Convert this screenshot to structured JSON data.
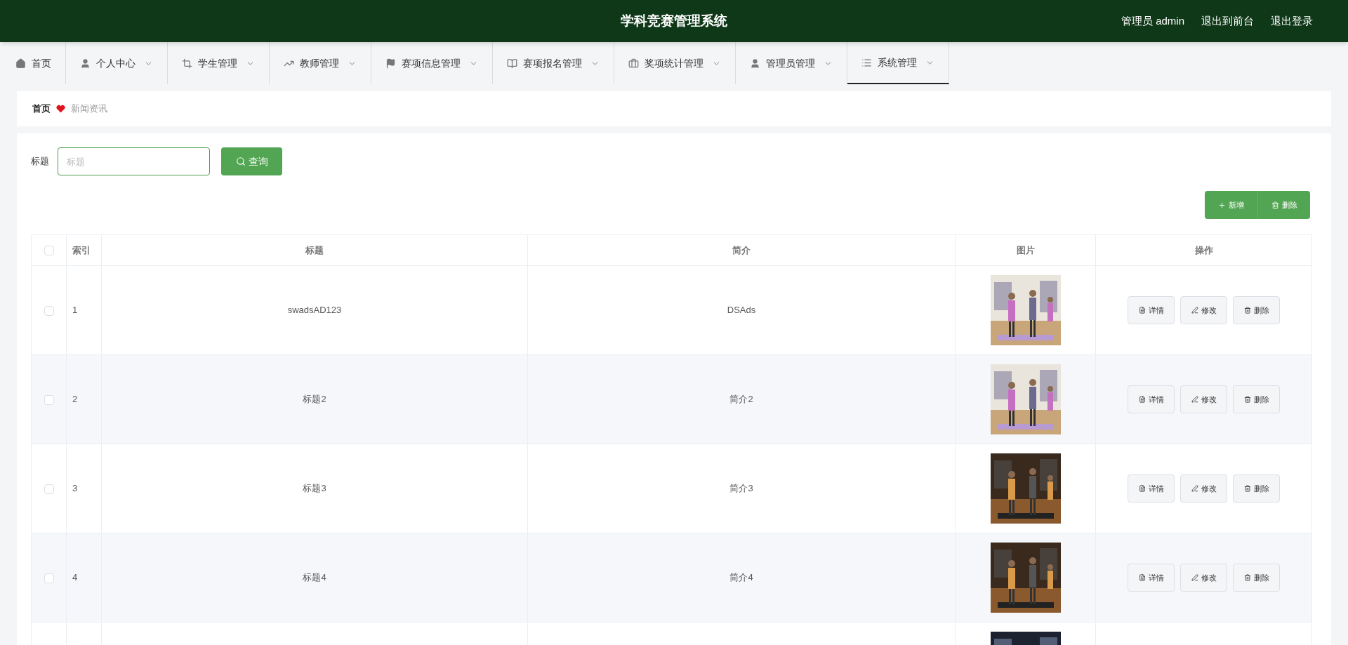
{
  "header": {
    "title": "学科竞赛管理系统",
    "user": "管理员 admin",
    "links": [
      "退出到前台",
      "退出登录"
    ]
  },
  "nav": [
    {
      "label": "首页",
      "dropdown": false,
      "selected": false
    },
    {
      "label": "个人中心",
      "dropdown": true,
      "selected": false
    },
    {
      "label": "学生管理",
      "dropdown": true,
      "selected": false
    },
    {
      "label": "教师管理",
      "dropdown": true,
      "selected": false
    },
    {
      "label": "赛项信息管理",
      "dropdown": true,
      "selected": false
    },
    {
      "label": "赛项报名管理",
      "dropdown": true,
      "selected": false
    },
    {
      "label": "奖项统计管理",
      "dropdown": true,
      "selected": false
    },
    {
      "label": "管理员管理",
      "dropdown": true,
      "selected": false
    },
    {
      "label": "系统管理",
      "dropdown": true,
      "selected": true
    }
  ],
  "breadcrumb": {
    "home": "首页",
    "current": "新闻资讯"
  },
  "search": {
    "label": "标题",
    "placeholder": "标题",
    "button": "查询"
  },
  "actions": {
    "add": "新增",
    "delete": "删除"
  },
  "table": {
    "columns": [
      "索引",
      "标题",
      "简介",
      "图片",
      "操作"
    ],
    "select_all_checked": false,
    "rows": [
      {
        "index": "1",
        "title": "swadsAD123",
        "intro": "DSAds",
        "checked": false,
        "picture": {
          "kind": "picture"
        },
        "buttons": [
          "详情",
          "修改",
          "删除"
        ]
      },
      {
        "index": "2",
        "title": "标题2",
        "intro": "简介2",
        "checked": false,
        "picture": {
          "kind": "picture"
        },
        "buttons": [
          "详情",
          "修改",
          "删除"
        ]
      },
      {
        "index": "3",
        "title": "标题3",
        "intro": "简介3",
        "checked": false,
        "picture": {
          "kind": "picture"
        },
        "buttons": [
          "详情",
          "修改",
          "删除"
        ]
      },
      {
        "index": "4",
        "title": "标题4",
        "intro": "简介4",
        "checked": false,
        "picture": {
          "kind": "picture"
        },
        "buttons": [
          "详情",
          "修改",
          "删除"
        ]
      },
      {
        "picture": {
          "kind": "picture"
        }
      }
    ]
  }
}
